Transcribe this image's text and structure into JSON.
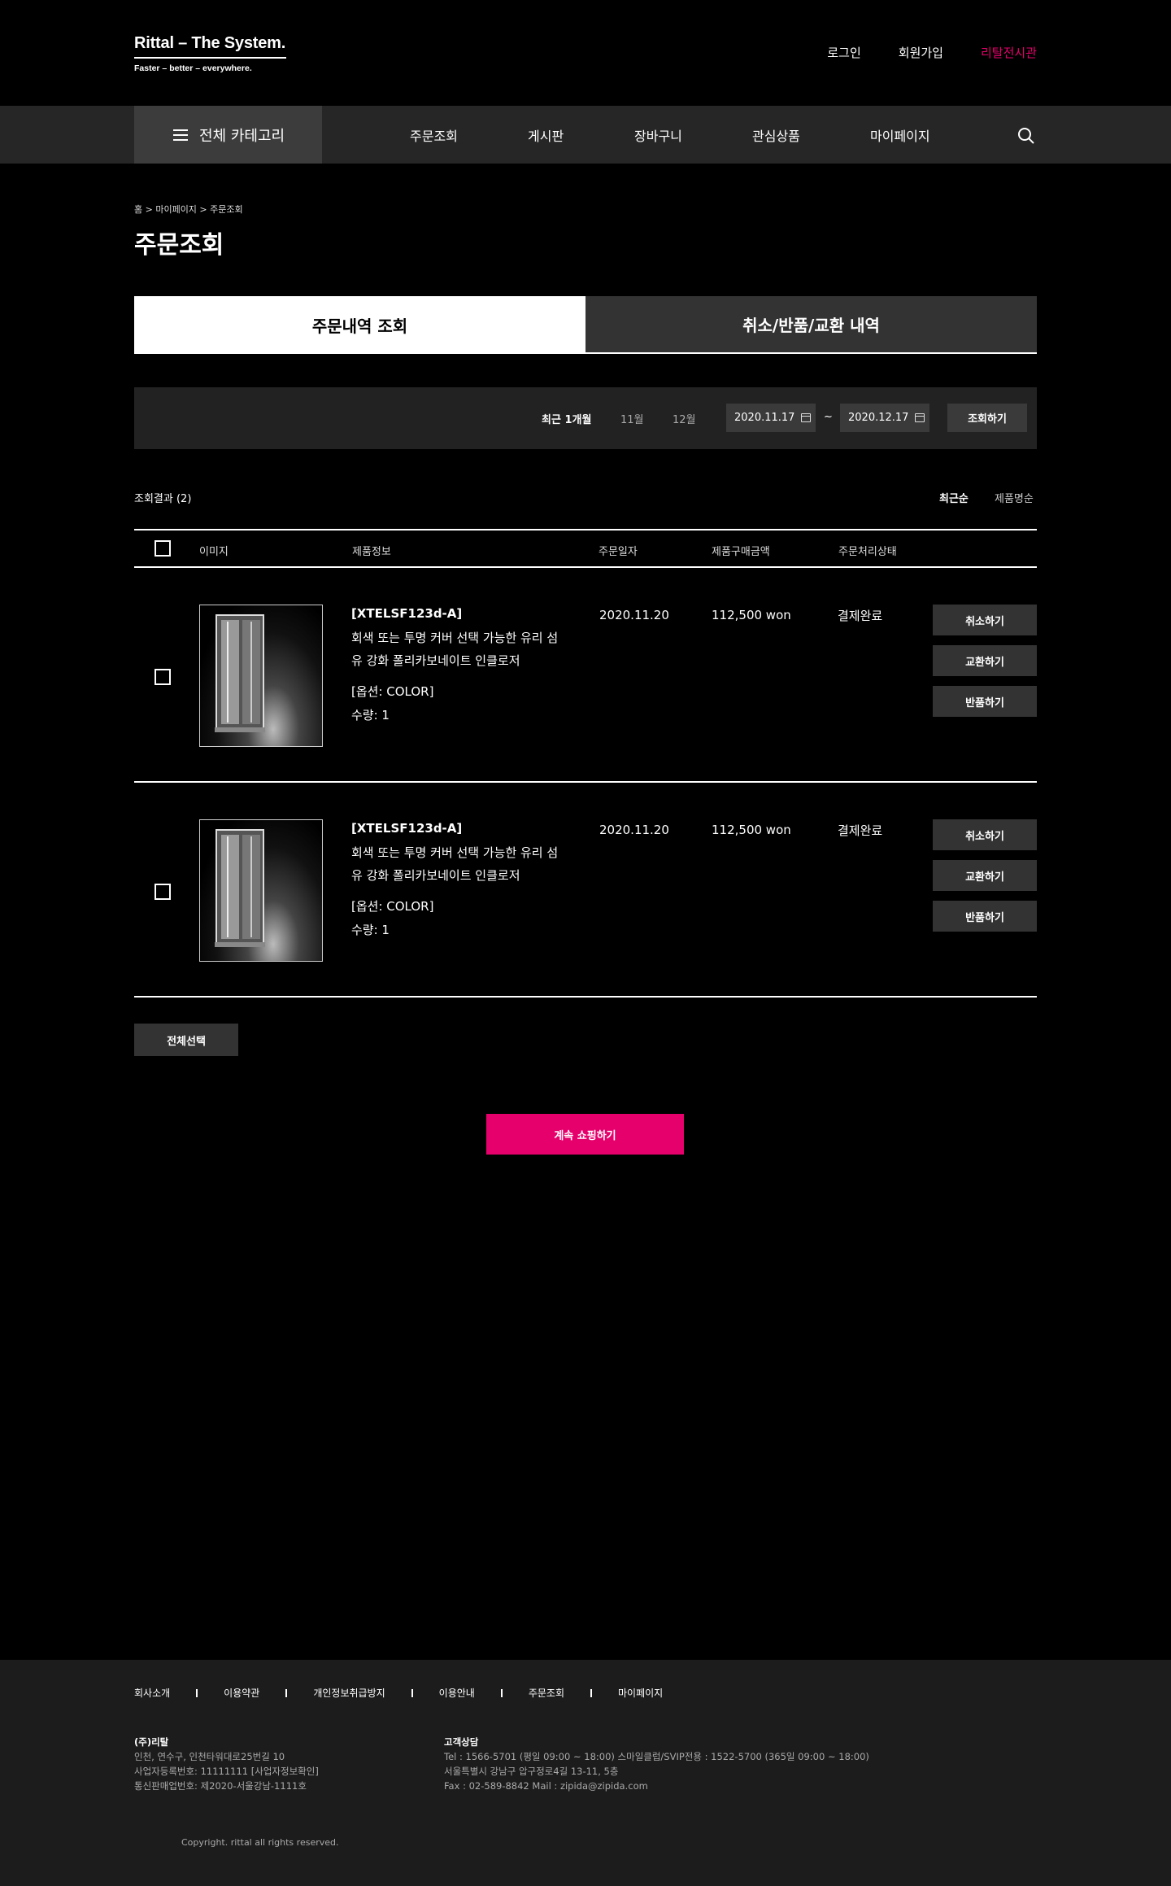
{
  "brand": {
    "logo_main": "Rittal – The System.",
    "logo_sub": "Faster – better – everywhere."
  },
  "top_links": {
    "login": "로그인",
    "signup": "회원가입",
    "showroom": "리탈전시관",
    "accent_color": "#e6006b"
  },
  "nav": {
    "category": "전체 카테고리",
    "items": [
      "주문조회",
      "게시판",
      "장바구니",
      "관심상품",
      "마이페이지"
    ]
  },
  "breadcrumb": "홈 > 마이페이지 > 주문조회",
  "page_title": "주문조회",
  "tabs": {
    "active": "주문내역 조회",
    "inactive": "취소/반품/교환 내역"
  },
  "filter": {
    "periods": [
      "최근 1개월",
      "11월",
      "12월"
    ],
    "date_from": "2020.11.17",
    "separator": "~",
    "date_to": "2020.12.17",
    "search_label": "조회하기"
  },
  "results": {
    "count_label": "조회결과 (2)",
    "sort_recent": "최근순",
    "sort_name": "제품명순"
  },
  "table": {
    "headers": [
      "이미지",
      "제품정보",
      "주문일자",
      "제품구매금액",
      "주문처리상태"
    ],
    "rows": [
      {
        "code": "[XTELSF123d-A]",
        "name": "회색 또는 투명 커버 선택 가능한 유리 섬유 강화 폴리카보네이트 인클로저",
        "option": "[옵션: COLOR]",
        "qty": "수량: 1",
        "date": "2020.11.20",
        "price": "112,500 won",
        "status": "결제완료",
        "actions": [
          "취소하기",
          "교환하기",
          "반품하기"
        ]
      },
      {
        "code": "[XTELSF123d-A]",
        "name": "회색 또는 투명 커버 선택 가능한 유리 섬유 강화 폴리카보네이트 인클로저",
        "option": "[옵션: COLOR]",
        "qty": "수량: 1",
        "date": "2020.11.20",
        "price": "112,500 won",
        "status": "결제완료",
        "actions": [
          "취소하기",
          "교환하기",
          "반품하기"
        ]
      }
    ]
  },
  "select_all_label": "전체선택",
  "continue_label": "계속 쇼핑하기",
  "footer": {
    "links": [
      "회사소개",
      "이용약관",
      "개인정보취급방지",
      "이용안내",
      "주문조회",
      "마이페이지"
    ],
    "company": {
      "name": "(주)리탈",
      "lines": [
        "인천, 연수구, 인천타워대로25번길 10",
        "사업자등록번호: 11111111 [사업자정보확인]",
        "통신판매업번호: 제2020-서울강남-1111호"
      ]
    },
    "support": {
      "title": "고객상담",
      "lines": [
        "Tel : 1566-5701 (평일 09:00 ~ 18:00)   스마일클럽/SVIP전용 : 1522-5700 (365일 09:00 ~ 18:00)",
        "서울특별시 강남구 압구정로4길 13-11, 5층",
        "Fax : 02-589-8842   Mail : zipida@zipida.com"
      ]
    },
    "copyright": "Copyright. rittal all rights reserved."
  }
}
